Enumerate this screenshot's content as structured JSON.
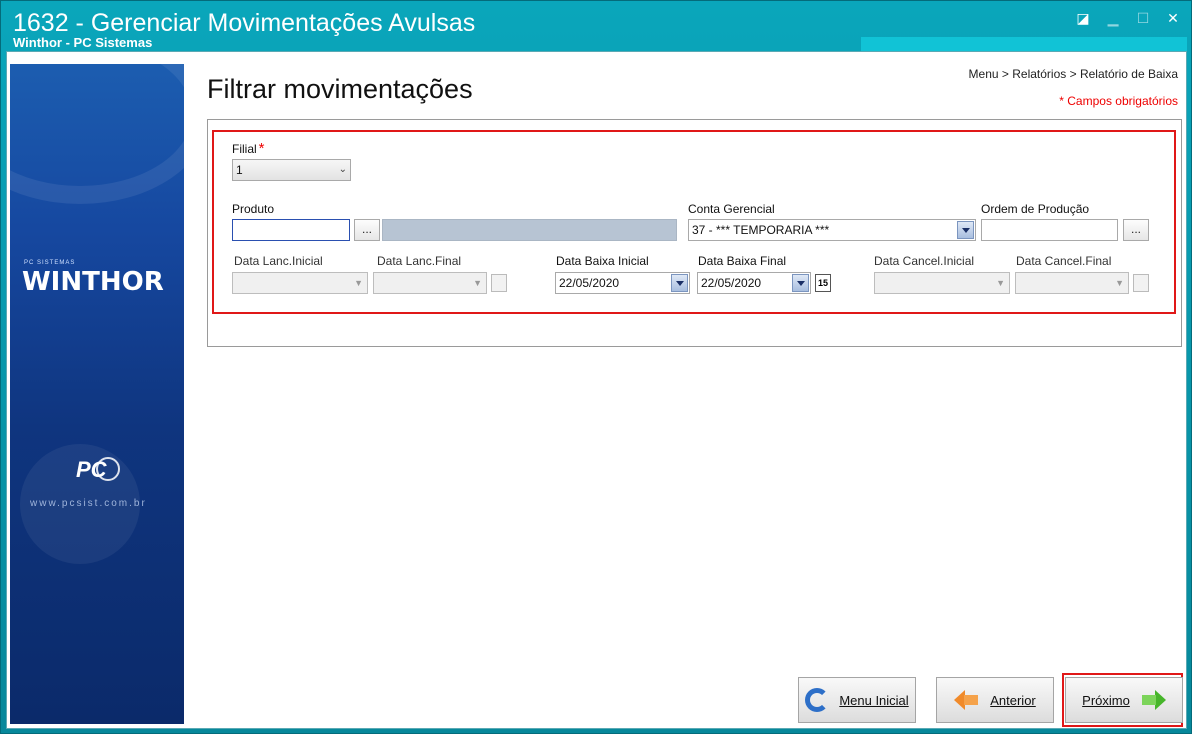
{
  "window": {
    "title": "1632 - Gerenciar Movimentações Avulsas",
    "subtitle": "Winthor - PC Sistemas",
    "controls": {
      "restore": "◪",
      "minimize": "▁",
      "maximize": "☐",
      "close": "✕"
    }
  },
  "sidebar": {
    "brand_small": "PC SISTEMAS",
    "brand": "WINTHOR",
    "pc_logo": "PC",
    "url": "www.pcsist.com.br"
  },
  "header": {
    "title": "Filtrar movimentações",
    "breadcrumb": "Menu > Relatórios > Relatório de Baixa",
    "required_note": "* Campos obrigatórios"
  },
  "filters": {
    "filial": {
      "label": "Filial",
      "required_mark": "*",
      "value": "1"
    },
    "produto": {
      "label": "Produto",
      "value": "",
      "lookup": "...",
      "description": ""
    },
    "conta_gerencial": {
      "label": "Conta Gerencial",
      "value": "37 - *** TEMPORARIA ***"
    },
    "ordem_producao": {
      "label": "Ordem de Produção",
      "value": "",
      "lookup": "..."
    },
    "data_lanc_inicial": {
      "label": "Data Lanc.Inicial",
      "value": ""
    },
    "data_lanc_final": {
      "label": "Data Lanc.Final",
      "value": ""
    },
    "data_baixa_inicial": {
      "label": "Data Baixa Inicial",
      "value": "22/05/2020"
    },
    "data_baixa_final": {
      "label": "Data Baixa Final",
      "value": "22/05/2020",
      "calendar_day": "15"
    },
    "data_cancel_inicial": {
      "label": "Data Cancel.Inicial",
      "value": ""
    },
    "data_cancel_final": {
      "label": "Data Cancel.Final",
      "value": ""
    }
  },
  "footer": {
    "menu_inicial": "Menu Inicial",
    "anterior": "Anterior",
    "proximo": "Próximo"
  },
  "colors": {
    "accent": "#0aa6bb",
    "highlight": "#e01818",
    "required": "#e00000"
  }
}
